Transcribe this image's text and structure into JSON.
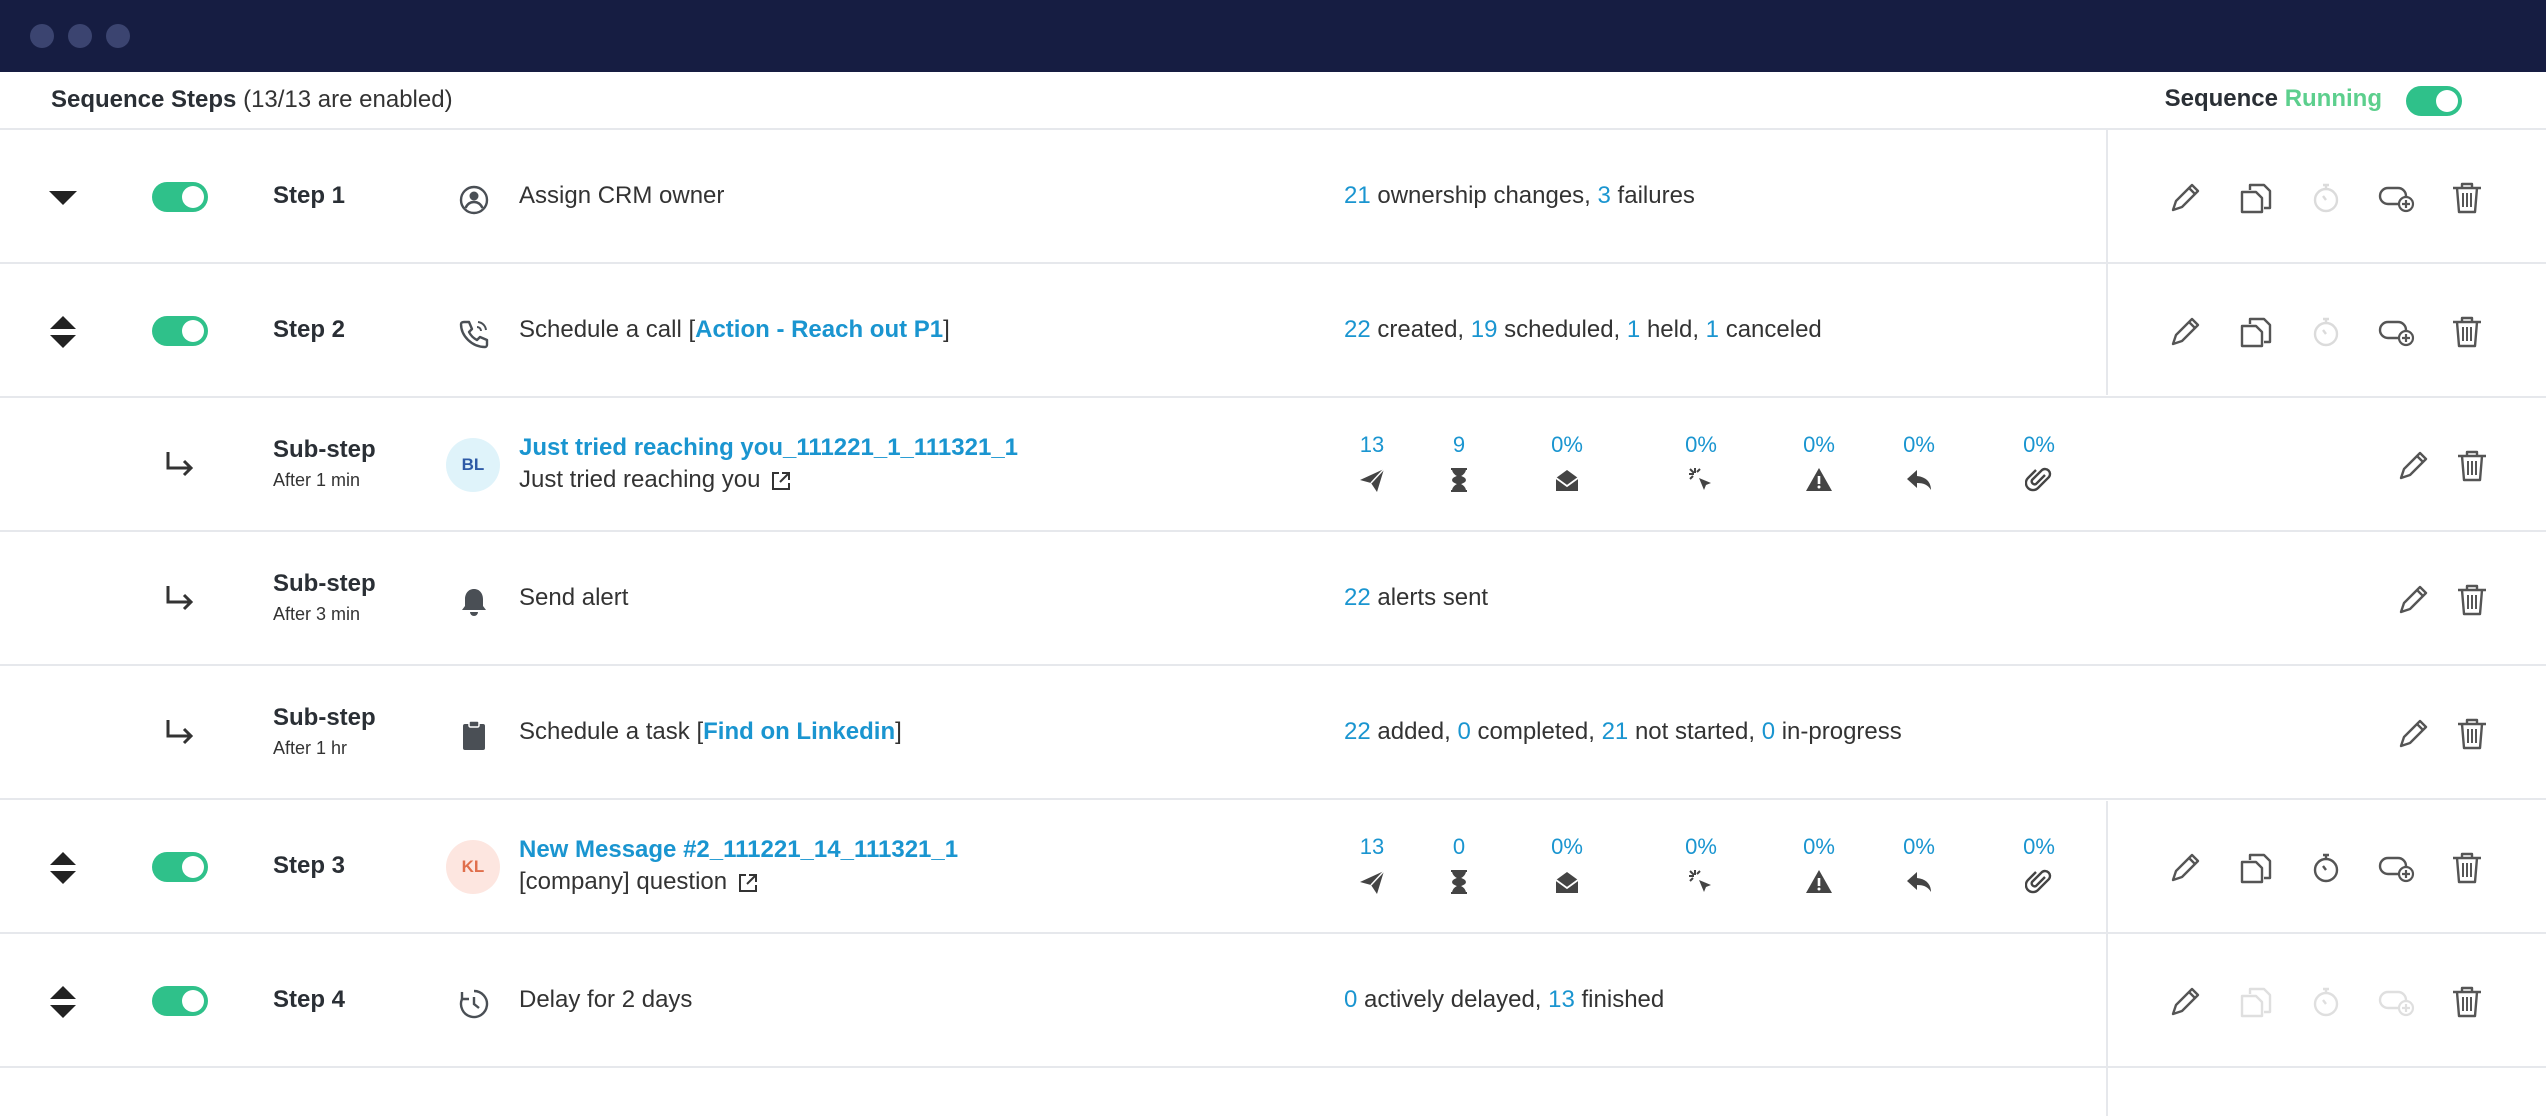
{
  "header": {
    "title": "Sequence Steps",
    "subtitle": "(13/13 are enabled)",
    "status_label": "Sequence",
    "status_value": "Running"
  },
  "colors": {
    "accent": "#1a95d0",
    "toggle_on": "#2fc18a",
    "running": "#5ccf8d",
    "titlebar": "#161d42"
  },
  "steps": [
    {
      "label": "Step 1",
      "icon": "user-circle-icon",
      "action": "Assign CRM owner",
      "stats": {
        "n1": "21",
        "t1": "ownership changes,",
        "n2": "3",
        "t2": "failures"
      }
    },
    {
      "label": "Step 2",
      "icon": "phone-icon",
      "action_pre": "Schedule a call [",
      "action_link": "Action - Reach out P1",
      "action_post": "]",
      "stats": {
        "n1": "22",
        "t1": "created,",
        "n2": "19",
        "t2": "scheduled,",
        "n3": "1",
        "t3": "held,",
        "n4": "1",
        "t4": "canceled"
      }
    },
    {
      "label": "Sub-step",
      "delay": "After 1 min",
      "avatar": "BL",
      "title": "Just tried reaching you_111221_1_111321_1",
      "subject": "Just tried reaching you",
      "metrics": [
        "13",
        "9",
        "0%",
        "0%",
        "0%",
        "0%",
        "0%"
      ]
    },
    {
      "label": "Sub-step",
      "delay": "After 3 min",
      "icon": "bell-icon",
      "action": "Send alert",
      "stats": {
        "n1": "22",
        "t1": "alerts sent"
      }
    },
    {
      "label": "Sub-step",
      "delay": "After 1 hr",
      "icon": "clipboard-icon",
      "action_pre": "Schedule a task [",
      "action_link": "Find on Linkedin",
      "action_post": "]",
      "stats": {
        "n1": "22",
        "t1": "added,",
        "n2": "0",
        "t2": "completed,",
        "n3": "21",
        "t3": "not started,",
        "n4": "0",
        "t4": "in-progress"
      }
    },
    {
      "label": "Step 3",
      "avatar": "KL",
      "title": "New Message #2_111221_14_111321_1",
      "subject": "[company] question",
      "metrics": [
        "13",
        "0",
        "0%",
        "0%",
        "0%",
        "0%",
        "0%"
      ]
    },
    {
      "label": "Step 4",
      "icon": "delay-clock-icon",
      "action": "Delay for 2 days",
      "stats": {
        "n1": "0",
        "t1": "actively delayed,",
        "n2": "13",
        "t2": "finished"
      }
    }
  ]
}
